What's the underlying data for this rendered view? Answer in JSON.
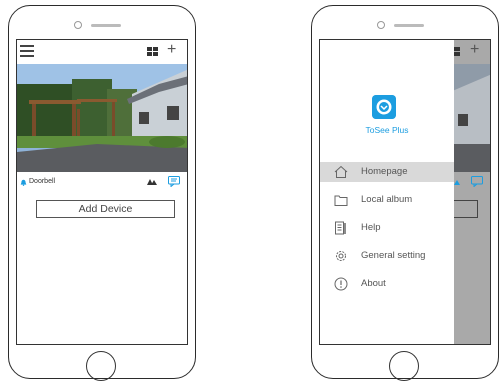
{
  "left_screen": {
    "device": {
      "name": "Doorbell"
    },
    "add_device_label": "Add Device"
  },
  "right_screen": {
    "app_name": "ToSee Plus",
    "menu": [
      {
        "label": "Homepage",
        "icon": "home-icon",
        "active": true
      },
      {
        "label": "Local album",
        "icon": "folder-icon",
        "active": false
      },
      {
        "label": "Help",
        "icon": "help-document-icon",
        "active": false
      },
      {
        "label": "General setting",
        "icon": "gear-icon",
        "active": false
      },
      {
        "label": "About",
        "icon": "info-icon",
        "active": false
      }
    ]
  },
  "colors": {
    "accent": "#1c9de0",
    "overlay": "#a9a9a9",
    "active_menu": "#d9d9d9"
  }
}
